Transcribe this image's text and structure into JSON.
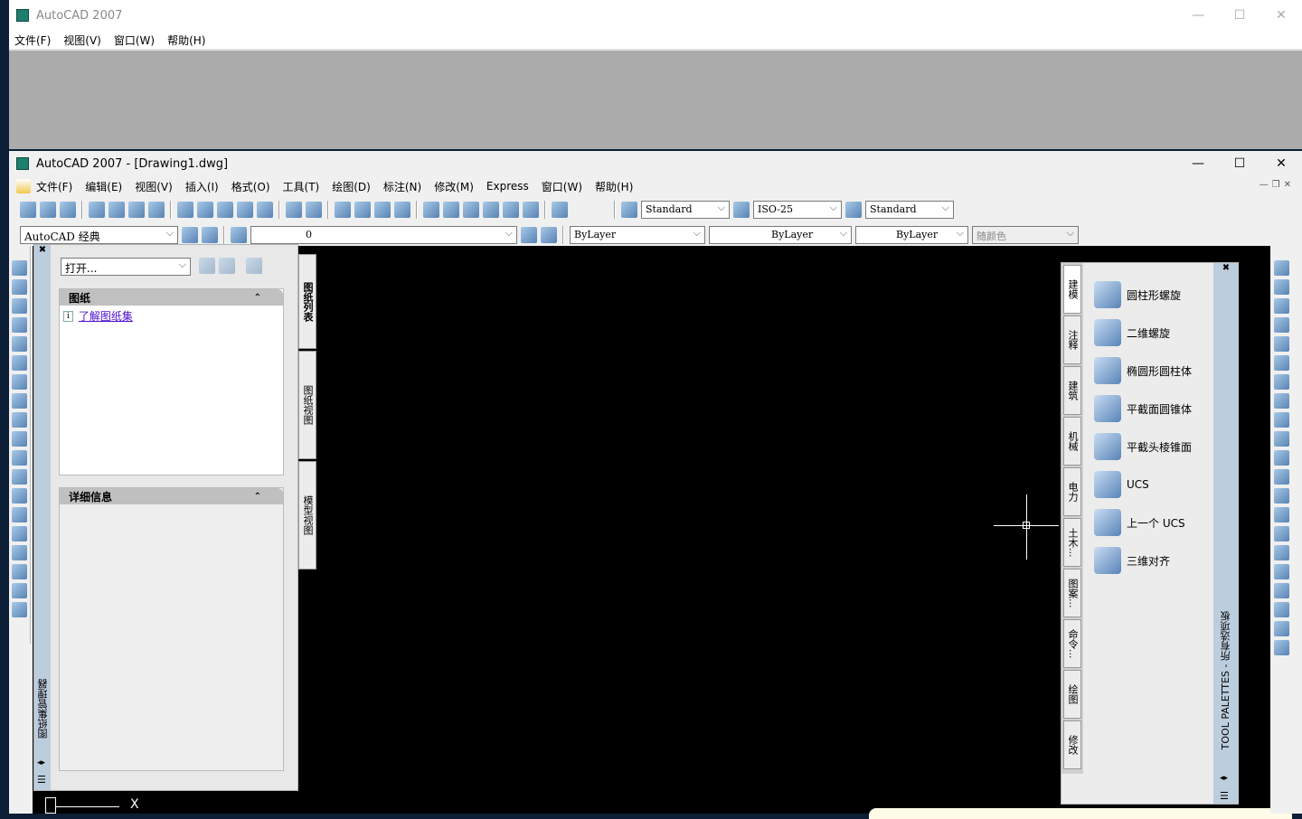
{
  "bg_window": {
    "title": "AutoCAD 2007",
    "menu": [
      "文件(F)",
      "视图(V)",
      "窗口(W)",
      "帮助(H)"
    ]
  },
  "main_window": {
    "title": "AutoCAD 2007 - [Drawing1.dwg]",
    "menu": [
      "文件(F)",
      "编辑(E)",
      "视图(V)",
      "插入(I)",
      "格式(O)",
      "工具(T)",
      "绘图(D)",
      "标注(N)",
      "修改(M)",
      "Express",
      "窗口(W)",
      "帮助(H)"
    ]
  },
  "toolbar": {
    "text_style": "Standard",
    "dim_style": "ISO-25",
    "table_style": "Standard",
    "workspace": "AutoCAD 经典",
    "layer": "0",
    "color": "ByLayer",
    "linetype": "ByLayer",
    "lineweight": "ByLayer",
    "plotstyle": "随颜色",
    "icons1": [
      "new-icon",
      "open-icon",
      "save-icon",
      "plot-icon",
      "preview-icon",
      "publish-icon",
      "web-icon",
      "cut-icon",
      "copy-icon",
      "paste-icon",
      "match-icon",
      "block-edit-icon",
      "undo-icon",
      "redo-icon",
      "pan-icon",
      "zoom-realtime-icon",
      "zoom-window-icon",
      "zoom-previous-icon",
      "properties-icon",
      "design-center-icon",
      "tool-palettes-icon",
      "sheetset-icon",
      "markup-icon",
      "calculator-icon",
      "help-icon"
    ]
  },
  "draw_tools": [
    "line-icon",
    "xline-icon",
    "polyline-icon",
    "polygon-icon",
    "rectangle-icon",
    "arc-icon",
    "circle-icon",
    "revcloud-icon",
    "spline-icon",
    "ellipse-icon",
    "ellipse-arc-icon",
    "insert-block-icon",
    "make-block-icon",
    "point-icon",
    "hatch-icon",
    "gradient-icon",
    "region-icon",
    "table-icon",
    "mtext-icon"
  ],
  "modify_tools": [
    "erase-icon",
    "copy-object-icon",
    "mirror-icon",
    "offset-icon",
    "array-icon",
    "move-icon",
    "rotate-icon",
    "scale-icon",
    "stretch-icon",
    "trim-icon",
    "extend-icon",
    "break-point-icon",
    "break-icon",
    "join-icon",
    "chamfer-icon",
    "fillet-icon",
    "explode-icon",
    "draworder-front-icon",
    "draworder-back-icon",
    "draworder-above-icon",
    "draworder-under-icon"
  ],
  "sheetset": {
    "open_label": "打开...",
    "sheets_header": "图纸",
    "learn_link": "了解图纸集",
    "details_header": "详细信息",
    "side_title": "图纸集管理器",
    "tabs": [
      "图纸列表",
      "图纸视图",
      "模型视图"
    ]
  },
  "tool_palette": {
    "side_title": "TOOL PALETTES - 所有选项板",
    "tabs": [
      "建模",
      "注释",
      "建筑",
      "机械",
      "电力",
      "土木...",
      "图案...",
      "命令...",
      "绘图",
      "修改"
    ],
    "tools": [
      {
        "label": "圆柱形螺旋",
        "icon": "helix-icon"
      },
      {
        "label": "二维螺旋",
        "icon": "spiral-icon"
      },
      {
        "label": "椭圆形圆柱体",
        "icon": "elliptical-cylinder-icon"
      },
      {
        "label": "平截面圆锥体",
        "icon": "frustum-cone-icon"
      },
      {
        "label": "平截头棱锥面",
        "icon": "frustum-pyramid-icon"
      },
      {
        "label": "UCS",
        "icon": "ucs-icon"
      },
      {
        "label": "上一个 UCS",
        "icon": "ucs-previous-icon"
      },
      {
        "label": "三维对齐",
        "icon": "3d-align-icon"
      }
    ]
  },
  "ucs_label": "X"
}
